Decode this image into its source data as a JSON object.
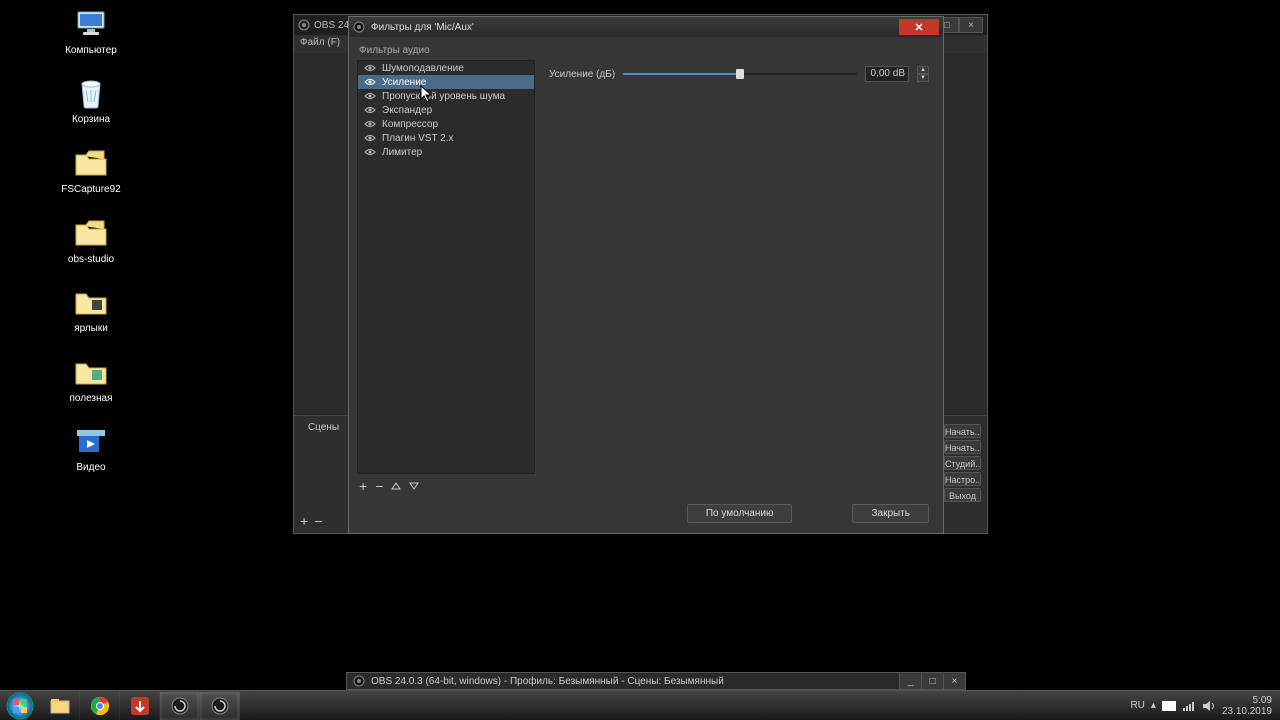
{
  "desktop_icons": [
    {
      "label": "Компьютер"
    },
    {
      "label": "Корзина"
    },
    {
      "label": "FSCapture92"
    },
    {
      "label": "obs-studio"
    },
    {
      "label": "ярлыки"
    },
    {
      "label": "полезная"
    },
    {
      "label": "Видео"
    }
  ],
  "obs_main": {
    "title": "OBS 24.0",
    "menu_file": "Файл (F)",
    "panels": {
      "scenes": "Сцены"
    },
    "controls": [
      "Начать...",
      "Начать...",
      "Студий...",
      "Настро...",
      "Выход"
    ]
  },
  "filters_dialog": {
    "title": "Фильтры для 'Mic/Aux'",
    "section": "Фильтры аудио",
    "filters": [
      "Шумоподавление",
      "Усиление",
      "Пропускной уровень шума",
      "Экспандер",
      "Компрессор",
      "Плагин VST 2.x",
      "Лимитер"
    ],
    "selected_index": 1,
    "prop": {
      "label": "Усиление (дБ)",
      "value_text": "0,00 dB",
      "min": -30,
      "max": 30,
      "value": 0
    },
    "btn_defaults": "По умолчанию",
    "btn_close": "Закрыть"
  },
  "secondary_taskbar": "OBS 24.0.3 (64-bit, windows) - Профиль: Безымянный - Сцены: Безымянный",
  "tray": {
    "lang": "RU",
    "time": "5:09",
    "date": "23.10.2019"
  }
}
